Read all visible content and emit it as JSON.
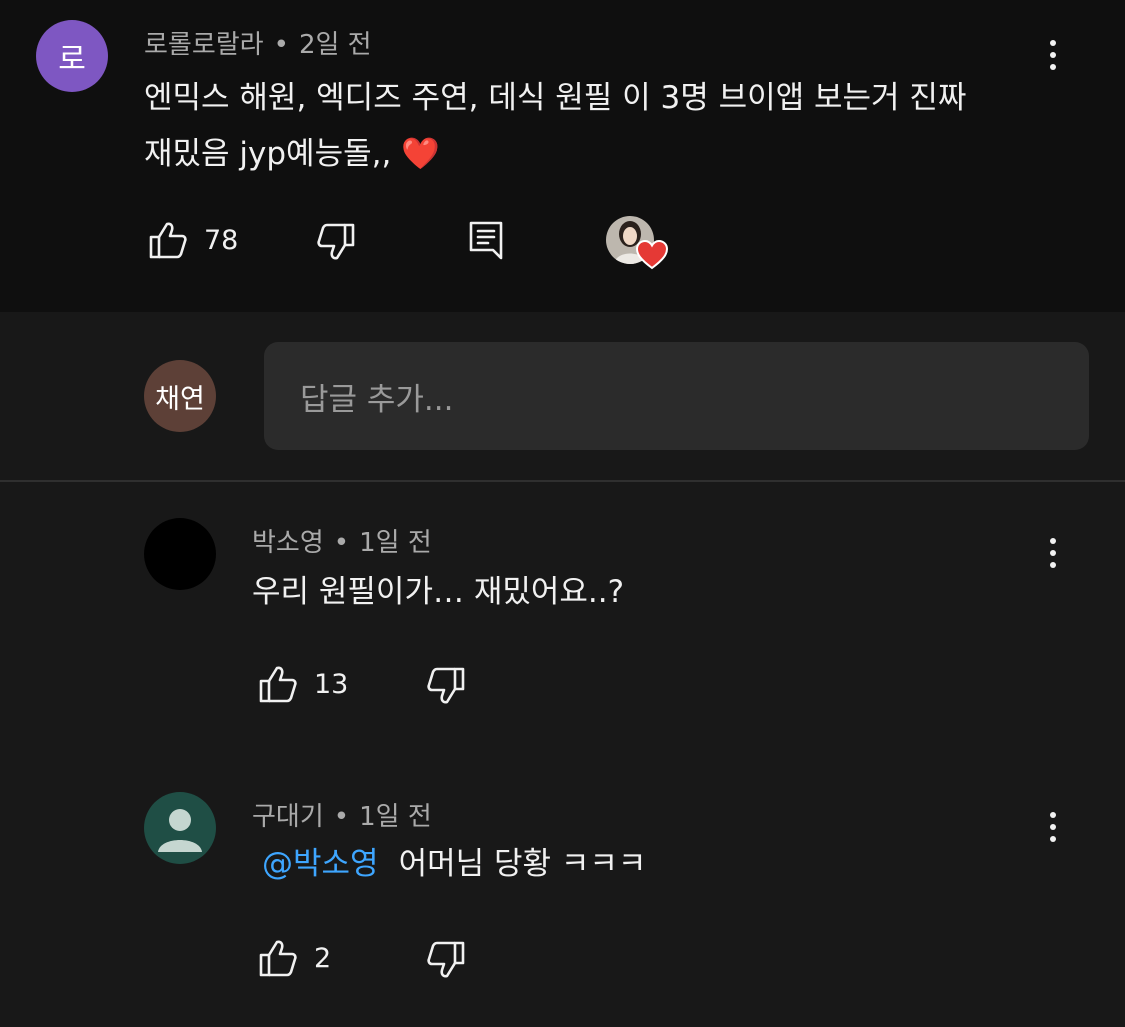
{
  "comment": {
    "avatar_letter": "로",
    "avatar_color": "#7e57c2",
    "author": "로롤로랄라",
    "time": "2일 전",
    "separator": "•",
    "text_line1": "엔믹스 해원, 엑디즈 주연, 데식 원필 이 3명 브이앱 보는거 진짜",
    "text_line2": "재밌음 jyp예능돌,, ❤️",
    "likes": "78",
    "icons": [
      "like-icon",
      "dislike-icon",
      "reply-icon",
      "creator-heart-icon",
      "more-icon"
    ]
  },
  "reply_input": {
    "avatar_letter": "채연",
    "avatar_color": "#5d4037",
    "placeholder": "답글 추가..."
  },
  "replies": [
    {
      "author": "박소영",
      "time": "1일 전",
      "text": "우리 원필이가… 재밌어요..?",
      "likes": "13",
      "avatar_color": "#000000"
    },
    {
      "author": "구대기",
      "time": "1일 전",
      "mention": "@박소영",
      "text": "어머님 당황 ㅋㅋㅋ",
      "likes": "2",
      "avatar_color": "#1f4e45"
    }
  ],
  "colors": {
    "background": "#181818",
    "top_background": "#0f0f0f",
    "mention": "#3ea6ff",
    "heart": "#e53935"
  }
}
